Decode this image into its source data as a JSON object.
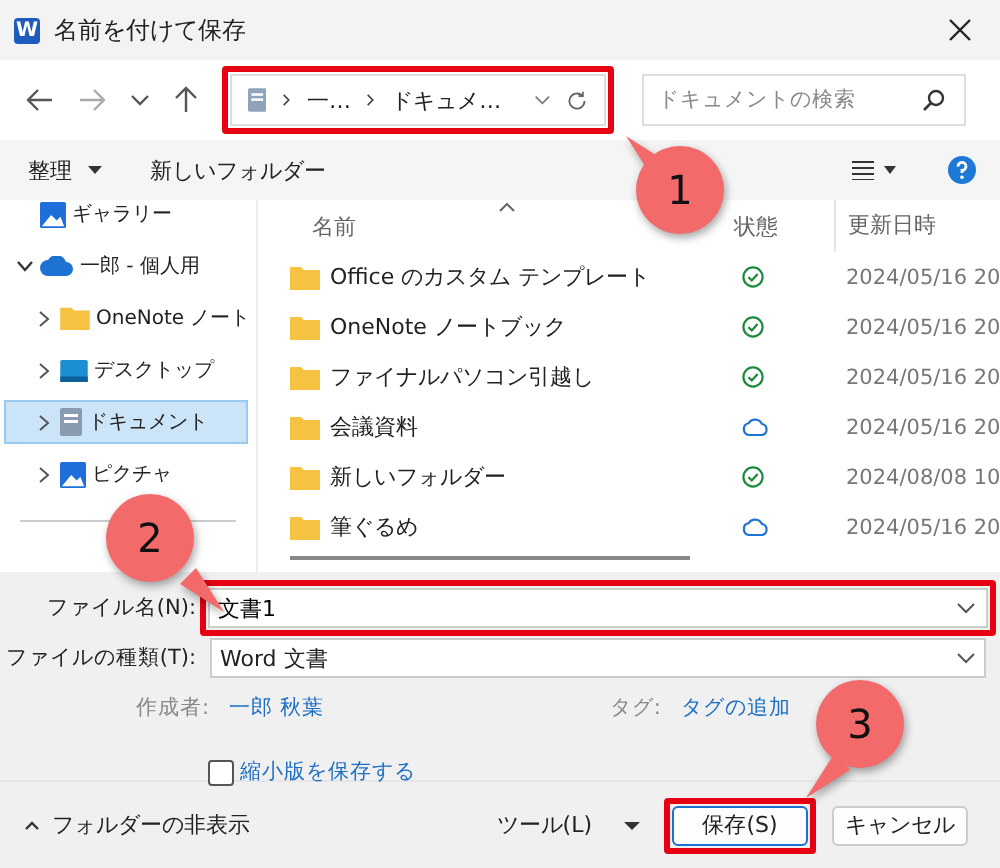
{
  "window": {
    "title": "名前を付けて保存",
    "app_icon_letter": "W"
  },
  "nav": {
    "address": {
      "segments": [
        "一…",
        "ドキュメ…"
      ],
      "highlighted": true
    },
    "search": {
      "placeholder": "ドキュメントの検索"
    }
  },
  "toolbar": {
    "organize": "整理",
    "new_folder": "新しいフォルダー"
  },
  "sidebar": {
    "items": [
      {
        "label": "ギャラリー",
        "kind": "gallery",
        "selected": false
      },
      {
        "label": "一郎 - 個人用",
        "kind": "cloud",
        "expanded": true,
        "selected": false,
        "children": [
          {
            "label": "OneNote ノート",
            "kind": "folder",
            "expanded": false,
            "selected": false
          },
          {
            "label": "デスクトップ",
            "kind": "desktop",
            "expanded": false,
            "selected": false
          },
          {
            "label": "ドキュメント",
            "kind": "documents",
            "expanded": false,
            "selected": true
          },
          {
            "label": "ピクチャ",
            "kind": "pictures",
            "expanded": false,
            "selected": false
          }
        ]
      }
    ]
  },
  "table": {
    "columns": [
      {
        "label": "名前",
        "sorted": true
      },
      {
        "label": "状態",
        "sorted": false
      },
      {
        "label": "更新日時",
        "sorted": false
      }
    ],
    "rows": [
      {
        "name": "Office のカスタム テンプレート",
        "synced": true,
        "date": "2024/05/16 20"
      },
      {
        "name": "OneNote ノートブック",
        "synced": true,
        "date": "2024/05/16 20"
      },
      {
        "name": "ファイナルパソコン引越し",
        "synced": true,
        "date": "2024/05/16 20"
      },
      {
        "name": "会議資料",
        "synced": false,
        "date": "2024/05/16 20"
      },
      {
        "name": "新しいフォルダー",
        "synced": true,
        "date": "2024/08/08 10"
      },
      {
        "name": "筆ぐるめ",
        "synced": false,
        "date": "2024/05/16 20"
      }
    ]
  },
  "form": {
    "file_name": {
      "label": "ファイル名(N):",
      "value": "文書1",
      "highlighted": true
    },
    "file_type": {
      "label": "ファイルの種類(T):",
      "value": "Word 文書"
    },
    "author": {
      "label": "作成者:",
      "value": "一郎 秋葉"
    },
    "tags": {
      "label": "タグ:",
      "value": "タグの追加"
    },
    "thumbnail": {
      "label": "縮小版を保存する",
      "checked": false
    }
  },
  "footer": {
    "hide_folders": "フォルダーの非表示",
    "tools": "ツール(L)",
    "buttons": [
      {
        "label": "保存(S)",
        "primary": true,
        "highlighted": true
      },
      {
        "label": "キャンセル",
        "primary": false,
        "highlighted": false
      }
    ]
  },
  "callouts": [
    {
      "number": "1"
    },
    {
      "number": "2"
    },
    {
      "number": "3"
    }
  ]
}
